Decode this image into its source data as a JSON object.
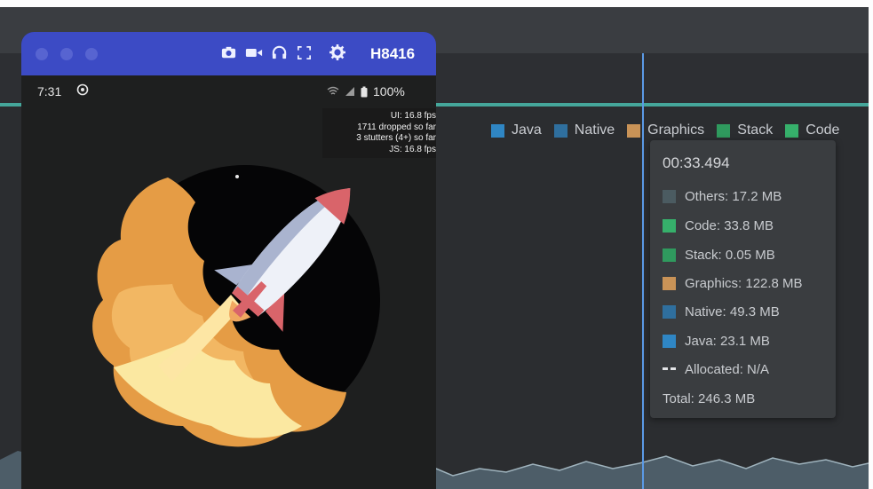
{
  "profiler": {
    "legend": [
      {
        "label": "Java",
        "color": "#2f86c4"
      },
      {
        "label": "Native",
        "color": "#2f6f9e"
      },
      {
        "label": "Graphics",
        "color": "#c99357"
      },
      {
        "label": "Stack",
        "color": "#2f9a5e"
      },
      {
        "label": "Code",
        "color": "#36b06b"
      }
    ],
    "tooltip": {
      "time": "00:33.494",
      "rows": [
        {
          "label": "Others: 17.2 MB",
          "color": "#4b5b61"
        },
        {
          "label": "Code: 33.8 MB",
          "color": "#36b06b"
        },
        {
          "label": "Stack: 0.05 MB",
          "color": "#2f9a5e"
        },
        {
          "label": "Graphics: 122.8 MB",
          "color": "#c99357"
        },
        {
          "label": "Native: 49.3 MB",
          "color": "#2f6f9e"
        },
        {
          "label": "Java: 23.1 MB",
          "color": "#2f86c4"
        },
        {
          "label": "Allocated: N/A",
          "color": "#e3e5e8"
        }
      ],
      "total": "Total: 246.3 MB"
    }
  },
  "device": {
    "name": "H8416",
    "header_icons": [
      "camera-icon",
      "video-icon",
      "headphones-icon",
      "fullscreen-icon"
    ],
    "status": {
      "time": "7:31",
      "battery": "100%"
    },
    "perf_overlay": [
      "UI: 16.8 fps",
      "1711 dropped so far",
      "3 stutters (4+) so far",
      "JS: 16.8 fps"
    ]
  }
}
